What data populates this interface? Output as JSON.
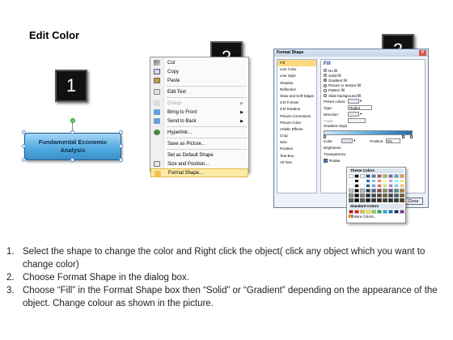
{
  "title": "Edit Color",
  "badges": [
    "1",
    "2",
    "3"
  ],
  "shape": {
    "line1": "Fundamental Economic",
    "line2": "Analysis"
  },
  "context_menu": {
    "items": [
      {
        "label": "Cut",
        "icon": "scissors-icon"
      },
      {
        "label": "Copy",
        "icon": "copy-icon"
      },
      {
        "label": "Paste",
        "icon": "paste-icon"
      },
      {
        "label": "Edit Text",
        "icon": "edit-text-icon"
      },
      {
        "label": "Group",
        "icon": "group-icon",
        "submenu": true,
        "disabled": true
      },
      {
        "label": "Bring to Front",
        "icon": "bring-front-icon",
        "submenu": true
      },
      {
        "label": "Send to Back",
        "icon": "send-back-icon",
        "submenu": true
      },
      {
        "label": "Hyperlink...",
        "icon": "hyperlink-icon"
      },
      {
        "label": "Save as Picture..."
      },
      {
        "label": "Set as Default Shape"
      },
      {
        "label": "Size and Position...",
        "icon": "size-position-icon"
      },
      {
        "label": "Format Shape...",
        "icon": "format-shape-icon",
        "highlighted": true
      }
    ]
  },
  "dialog": {
    "title": "Format Shape",
    "nav": [
      "Fill",
      "Line Color",
      "Line Style",
      "Shadow",
      "Reflection",
      "Glow and Soft Edges",
      "3-D Format",
      "3-D Rotation",
      "Picture Corrections",
      "Picture Color",
      "Artistic Effects",
      "Crop",
      "Size",
      "Position",
      "Text Box",
      "Alt Text"
    ],
    "fill_heading": "Fill",
    "fill_options": [
      "No fill",
      "Solid fill",
      "Gradient fill",
      "Picture or texture fill",
      "Pattern fill",
      "Slide background fill"
    ],
    "preset_label": "Preset colors:",
    "type_label": "Type:",
    "type_value": "Radial",
    "direction_label": "Direction:",
    "angle_label": "Angle:",
    "gradient_stops_label": "Gradient stops",
    "color_label": "Color",
    "position_label": "Position:",
    "position_value": "0%",
    "brightness_label": "Brightness",
    "transparency_label": "Transparency",
    "rotate_label": "Rotate",
    "close_label": "Close"
  },
  "color_popup": {
    "theme_header": "Theme Colors",
    "standard_header": "Standard Colors",
    "more_colors": "More Colors..."
  },
  "steps": [
    "Select the shape to change the color and Right click the object( click any object which you want to change color)",
    "Choose Format Shape in the dialog box.",
    "Choose “Fill” in the Format Shape box then “Solid” or “Gradient” depending on the appearance of the object. Change colour as shown in the picture."
  ]
}
